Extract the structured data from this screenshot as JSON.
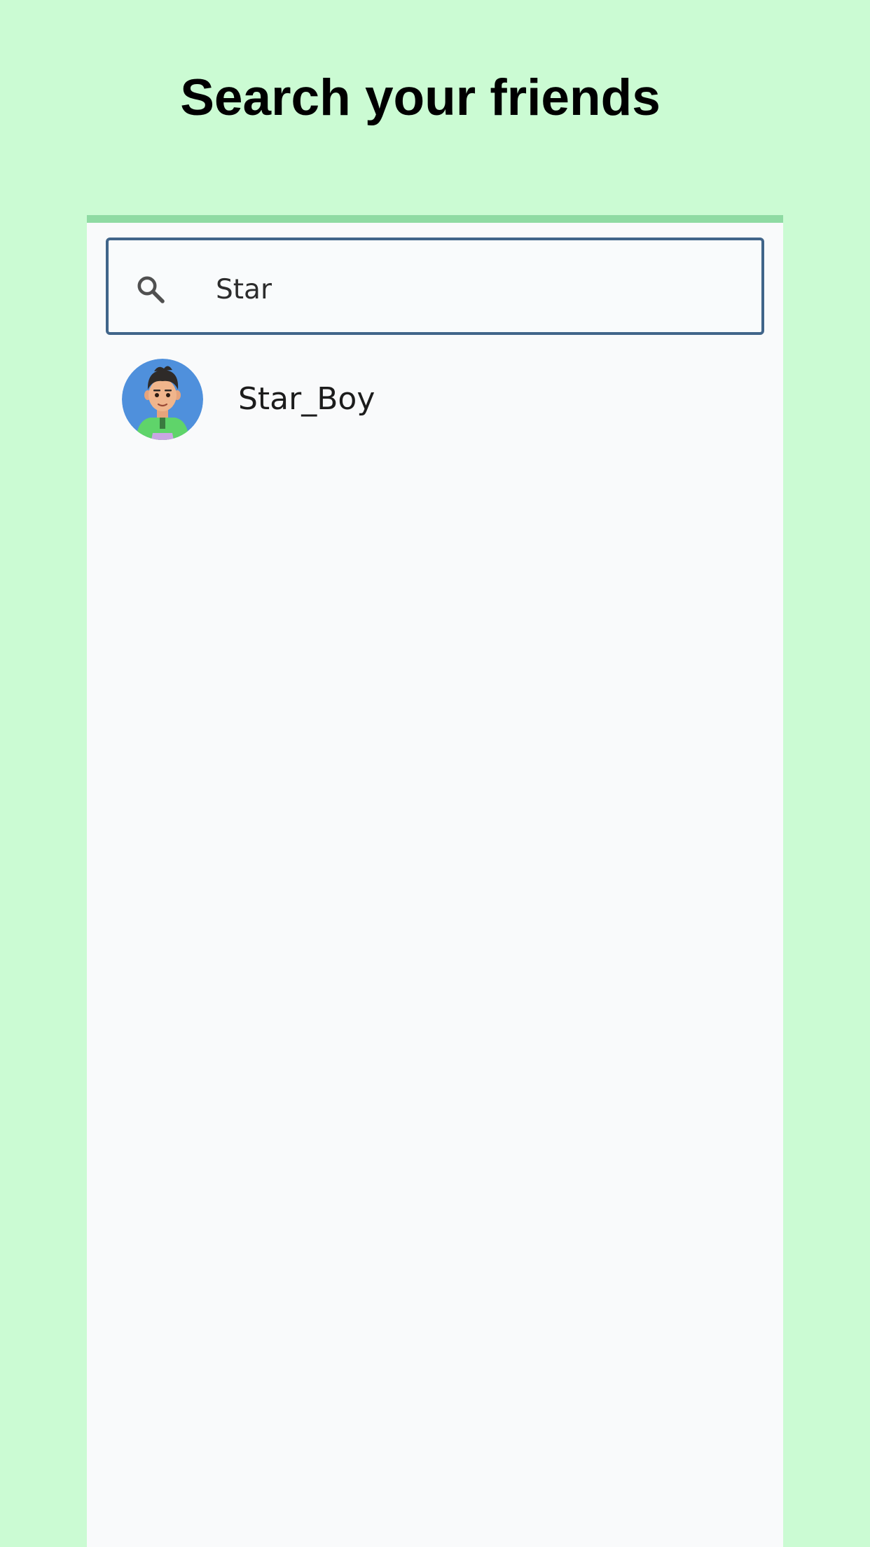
{
  "theme": {
    "background": "#cbfbd3",
    "panel_background": "#f9fafb",
    "panel_top_bar": "#8fdba3",
    "search_border": "#41658a",
    "icon_color": "#505050"
  },
  "header": {
    "title": "Search your friends"
  },
  "search": {
    "icon": "search-icon",
    "value": "Star",
    "placeholder": ""
  },
  "results": [
    {
      "name": "Star_Boy",
      "avatar": "avatar-boy-green-shirt"
    }
  ]
}
